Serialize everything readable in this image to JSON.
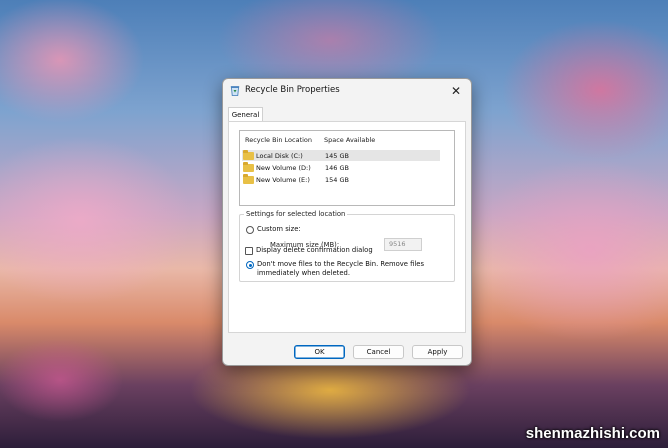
{
  "window": {
    "title": "Recycle Bin Properties",
    "close_glyph": "✕",
    "icon": "recycle-bin-icon"
  },
  "tabs": [
    {
      "label": "General",
      "active": true
    }
  ],
  "locations": {
    "columns": {
      "location": "Recycle Bin Location",
      "space": "Space Available"
    },
    "rows": [
      {
        "name": "Local Disk (C:)",
        "space": "145 GB",
        "selected": true
      },
      {
        "name": "New Volume (D:)",
        "space": "146 GB",
        "selected": false
      },
      {
        "name": "New Volume (E:)",
        "space": "154 GB",
        "selected": false
      }
    ]
  },
  "settings": {
    "group_label": "Settings for selected location",
    "custom_size_label": "Custom size:",
    "max_size_label": "Maximum size (MB):",
    "max_size_value": "9516",
    "no_move_label_line1": "Don't move files to the Recycle Bin. Remove files",
    "no_move_label_line2": "immediately when deleted.",
    "selected_option": "no_move"
  },
  "confirm_dialog_label": "Display delete confirmation dialog",
  "buttons": {
    "ok": "OK",
    "cancel": "Cancel",
    "apply": "Apply"
  },
  "watermark": "shenmazhishi.com",
  "colors": {
    "accent": "#0067c0",
    "folder": "#e8c046"
  }
}
